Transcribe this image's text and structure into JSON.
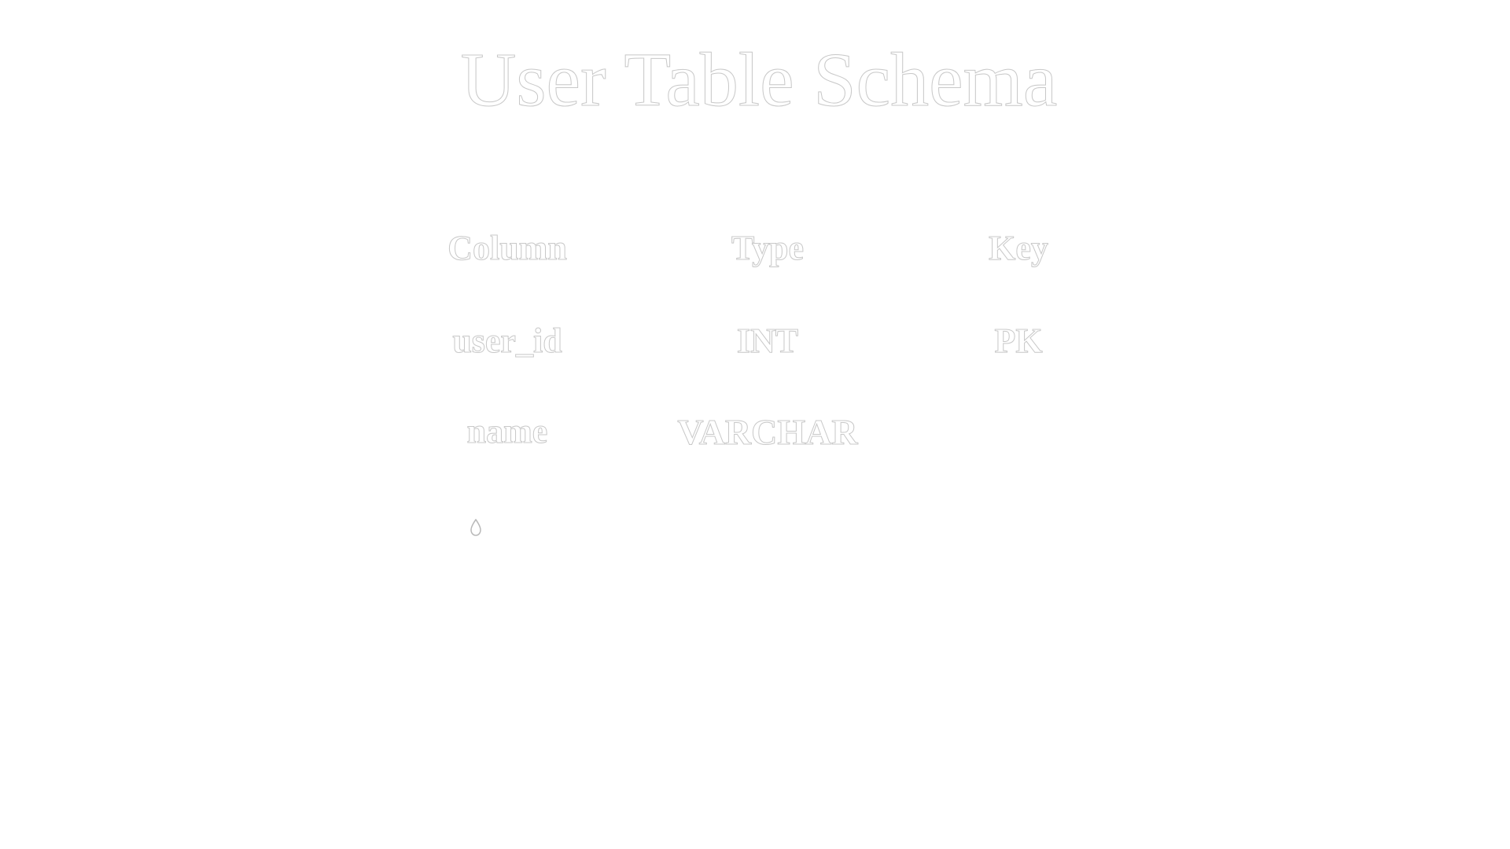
{
  "title": "User Table Schema",
  "table": {
    "headers": [
      "Column",
      "Type",
      "Key"
    ],
    "rows": [
      [
        "user_id",
        "INT",
        "PK"
      ],
      [
        "name",
        "VARCHAR",
        ""
      ]
    ]
  },
  "extra_glyph": {
    "icon": "drop-icon"
  },
  "colors": {
    "background": "#ffffff",
    "text_outline": "#c8c8c8",
    "text_fill": "#ffffff"
  }
}
